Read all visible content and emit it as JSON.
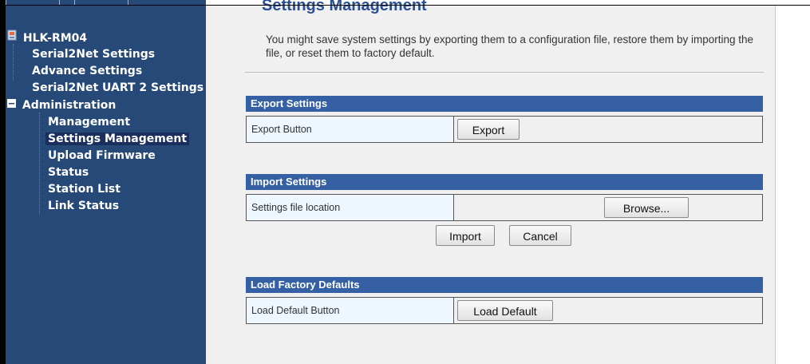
{
  "sidebar": {
    "top_buttons": [
      "",
      ""
    ],
    "root": "HLK-RM04",
    "items": [
      {
        "label": "Serial2Net Settings"
      },
      {
        "label": "Advance Settings"
      },
      {
        "label": "Serial2Net UART 2 Settings"
      }
    ],
    "admin": {
      "label": "Administration",
      "items": [
        {
          "label": "Management"
        },
        {
          "label": "Settings Management",
          "selected": true
        },
        {
          "label": "Upload Firmware"
        },
        {
          "label": "Status"
        },
        {
          "label": "Station List"
        },
        {
          "label": "Link Status"
        }
      ]
    }
  },
  "main": {
    "title": "Settings Management",
    "intro": "You might save system settings by exporting them to a configuration file, restore them by importing the file, or reset them to factory default.",
    "export": {
      "heading": "Export Settings",
      "row_label": "Export Button",
      "button": "Export"
    },
    "import": {
      "heading": "Import Settings",
      "row_label": "Settings file location",
      "browse_button": "Browse...",
      "file_value": "",
      "import_button": "Import",
      "cancel_button": "Cancel"
    },
    "factory": {
      "heading": "Load Factory Defaults",
      "row_label": "Load Default Button",
      "button": "Load Default"
    }
  },
  "colors": {
    "sidebar_bg": "#264978",
    "section_header": "#3561a4",
    "title": "#2a4f93",
    "label_cell": "#eef7ff"
  }
}
